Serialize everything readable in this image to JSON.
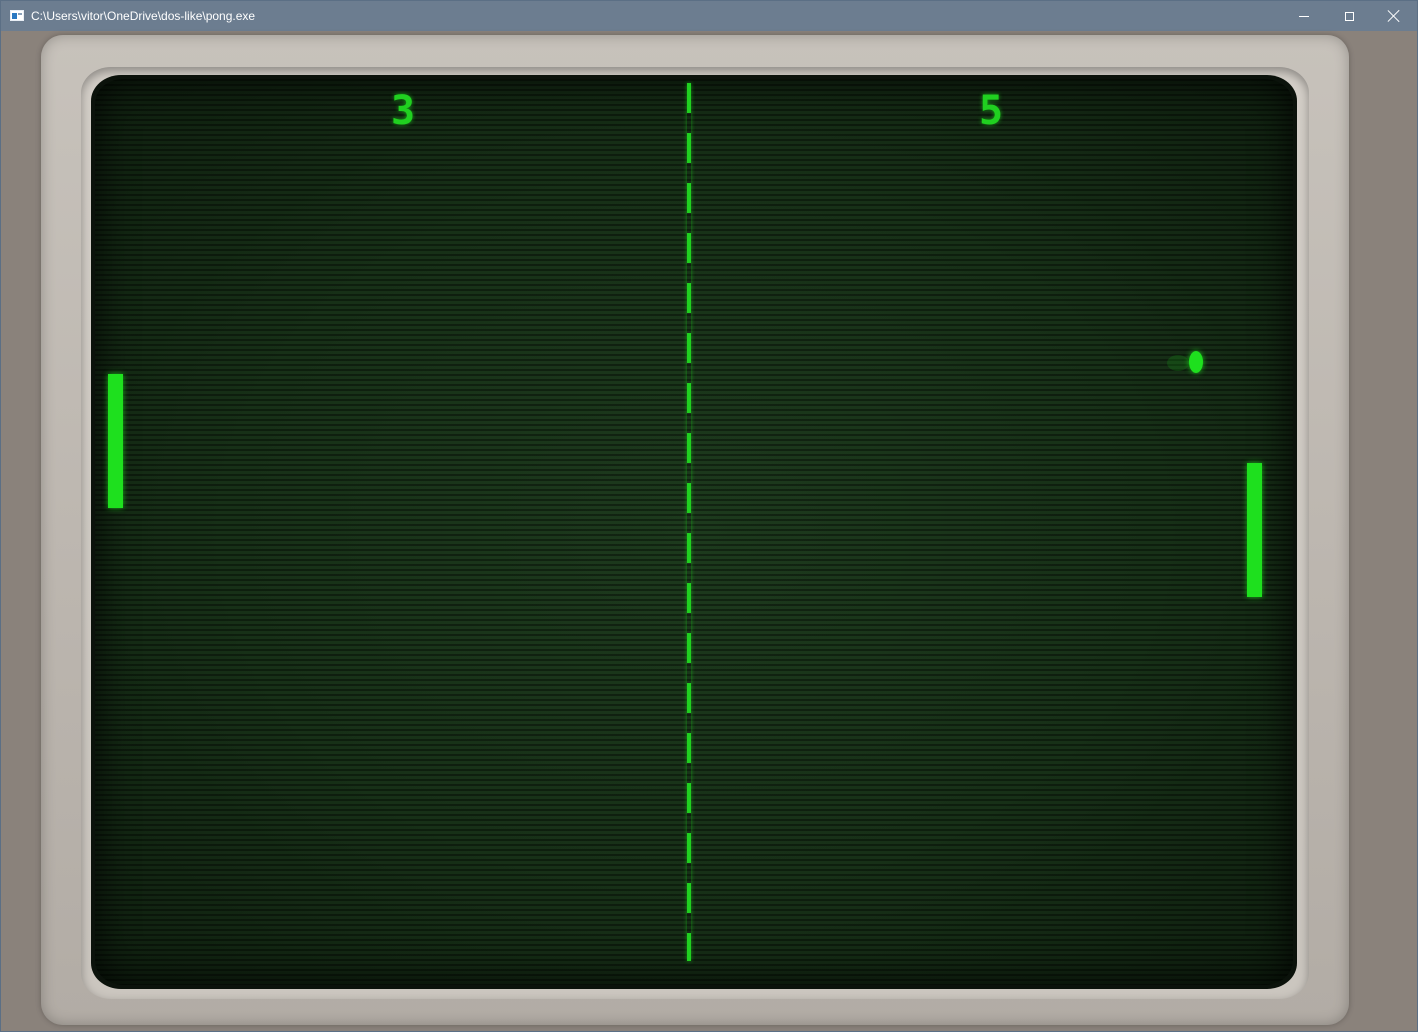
{
  "window": {
    "title": "C:\\Users\\vitor\\OneDrive\\dos-like\\pong.exe",
    "icon": "console-app-icon",
    "controls": {
      "minimize_icon": "minimize-icon",
      "maximize_icon": "maximize-icon",
      "close_icon": "close-icon"
    }
  },
  "game": {
    "name_shown": "",
    "left_score": "3",
    "right_score": "5",
    "colors": {
      "phosphor_green": "#1ee01e",
      "screen_background": "#173017",
      "bezel": "#c7c2bb"
    }
  }
}
